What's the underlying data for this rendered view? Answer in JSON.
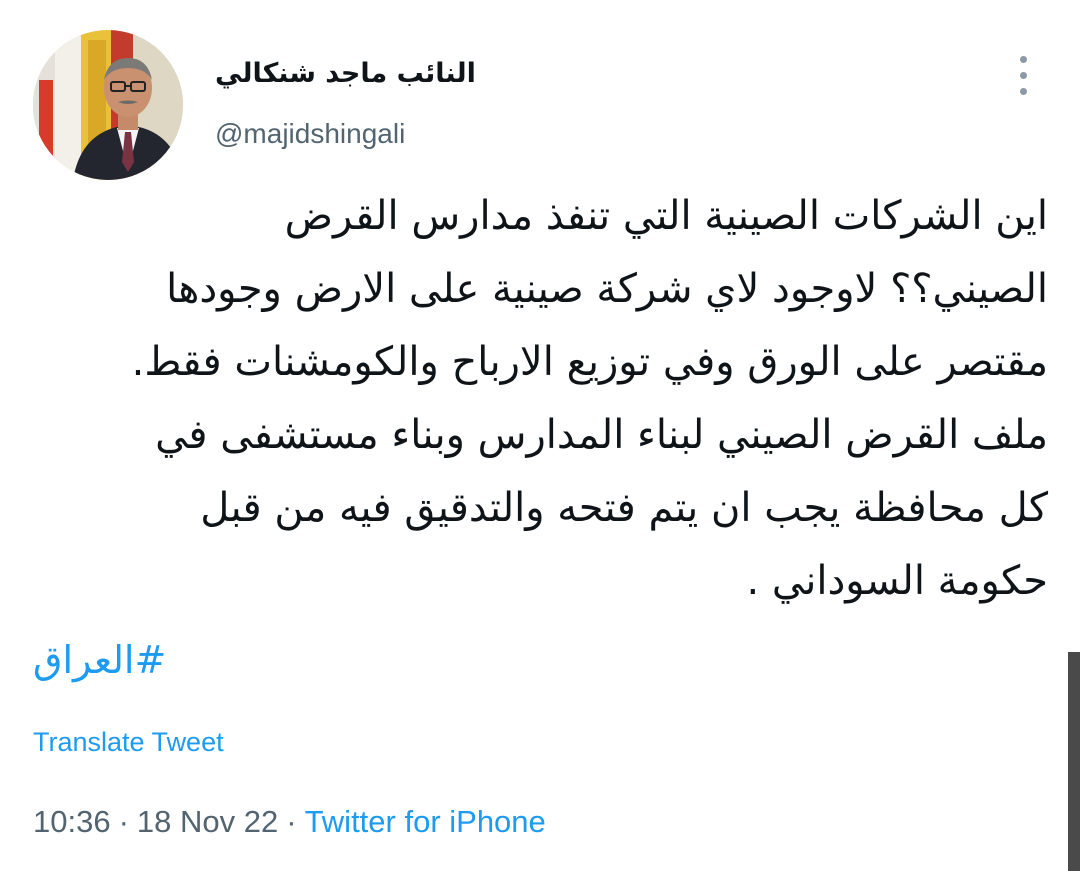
{
  "author": {
    "display_name": "النائب ماجد شنكالي",
    "handle": "@majidshingali"
  },
  "tweet": {
    "lines": [
      "اين الشركات الصينية التي تنفذ مدارس القرض",
      "الصيني؟؟ لاوجود لاي شركة صينية على الارض وجودها",
      "مقتصر على الورق وفي توزيع الارباح والكومشنات فقط.",
      "ملف القرض الصيني لبناء المدارس وبناء مستشفى في",
      "كل محافظة يجب ان يتم فتحه والتدقيق فيه من قبل",
      "حكومة السوداني ."
    ],
    "hashtag": "#العراق",
    "translate_label": "Translate Tweet",
    "time": "10:36",
    "date": "18 Nov 22",
    "separator": "·",
    "source": "Twitter for iPhone"
  },
  "icons": {
    "more": "more-vertical-icon"
  },
  "colors": {
    "link": "#1d9bf0",
    "secondary_text": "#536471",
    "primary_text": "#0f1419"
  }
}
